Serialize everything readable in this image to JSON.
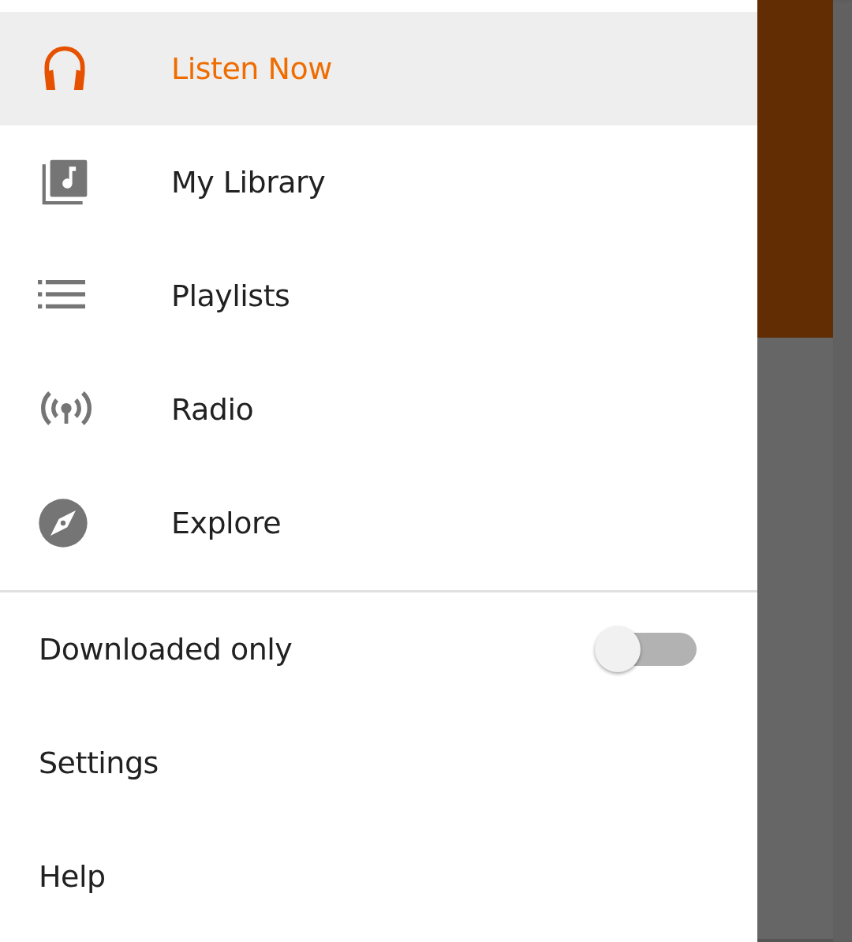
{
  "nav_items": [
    {
      "label": "Listen Now",
      "selected": true
    },
    {
      "label": "My Library",
      "selected": false
    },
    {
      "label": "Playlists",
      "selected": false
    },
    {
      "label": "Radio",
      "selected": false
    },
    {
      "label": "Explore",
      "selected": false
    }
  ],
  "settings_items": [
    {
      "kind": "toggle",
      "label": "Downloaded only",
      "on": false
    },
    {
      "kind": "plain",
      "label": "Settings"
    },
    {
      "kind": "plain",
      "label": "Help"
    }
  ]
}
